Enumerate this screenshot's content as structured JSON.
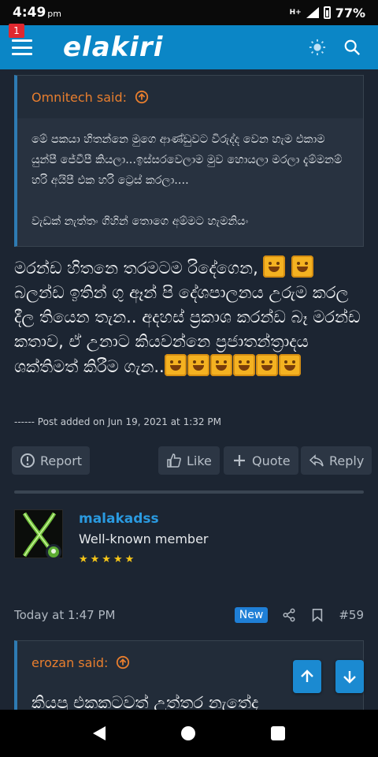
{
  "status_bar": {
    "time": "4:49",
    "ampm": "pm",
    "network": "H+",
    "battery": "77%"
  },
  "header": {
    "logo": "elakiri",
    "notification_count": "1"
  },
  "quote1": {
    "author_label": "Omnitech said:",
    "paragraphs": [
      "මේ පකයා හිතන්නෙ මුගෙ ආණ්ඩුවට විරුද්ද වෙන හැම එකාම යුන්පී ජේවීපී කියලා...ඉස්සරවෙලාම මුව හොයලා මරලා දැම්මනම් හරි අයිපී එක හරි ට්‍රෙස් කරලා....",
      "වැඩක් නැත්තං ගිහින් තොගෙ අම්මට හැමනියං"
    ]
  },
  "post": {
    "line1": "මරන්ඩ හිතනෙ තරමටම රිදේගෙන,",
    "line2": "බලන්ඩ ඉතින් ගු ඈන් පි දේශපාලනය උරුම කරල දීල තියෙන තැන.. අදහස් ප්‍රකාශ කරන්ඩ බෑ මරන්ඩ කතාව, ඒ උනාට කියවන්නෙ ප්‍රජාතන්ත්‍රාදය ශක්තිමත් කිරීම ගැන..",
    "post_added": "------ Post added on Jun 19, 2021 at 1:32 PM"
  },
  "actions": {
    "report": "Report",
    "like": "Like",
    "quote": "Quote",
    "reply": "Reply"
  },
  "member": {
    "username": "malakadss",
    "title": "Well-known member",
    "stars": "★★★★★"
  },
  "meta": {
    "time": "Today at 1:47 PM",
    "new_badge": "New",
    "post_number": "#59"
  },
  "quote2": {
    "author_label": "erozan said:",
    "cutoff_text": "කියපු එකකටවත් උත්තර නැතේද"
  },
  "colors": {
    "header": "#0b86c6",
    "background": "#1c2532",
    "accent_orange": "#e87e2e",
    "link_blue": "#2a9ae0"
  }
}
